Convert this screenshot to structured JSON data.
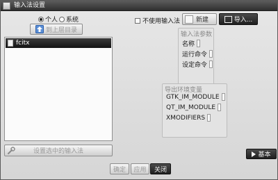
{
  "window": {
    "title": "输入法设置"
  },
  "scope": {
    "personal_label": "个人",
    "system_label": "系统",
    "selected": "personal"
  },
  "toolbar": {
    "up_label": "到上层目录",
    "disable_im_label": "不使用输入法",
    "new_label": "新建",
    "import_label": "导入..."
  },
  "im_list": {
    "items": [
      {
        "label": "fcitx"
      }
    ]
  },
  "set_selected_label": "设置选中的输入法",
  "params": {
    "title": "输入法参数",
    "rows": [
      {
        "label": "名称"
      },
      {
        "label": "运行命令"
      },
      {
        "label": "设定命令"
      }
    ]
  },
  "env": {
    "title": "导出环境变量",
    "rows": [
      {
        "label": "GTK_IM_MODULE"
      },
      {
        "label": "QT_IM_MODULE"
      },
      {
        "label": "XMODIFIERS"
      }
    ]
  },
  "basic_label": "基本",
  "footer": {
    "ok_label": "确定",
    "apply_label": "应用",
    "close_label": "关闭"
  },
  "colors": {
    "selection": "#1e1e1e",
    "titlebar": "#3a3a3a",
    "accent_arrow": "#3a7bd5"
  }
}
